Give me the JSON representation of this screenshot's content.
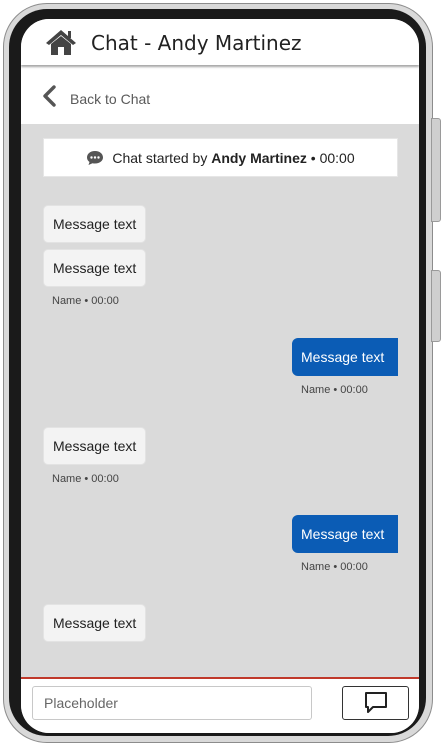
{
  "header": {
    "title": "Chat - Andy Martinez",
    "home_icon": "home-icon"
  },
  "nav": {
    "back_label": "Back to Chat",
    "back_icon": "chevron-left-icon"
  },
  "chat": {
    "started_prefix": "Chat started by",
    "started_name": "Andy Martinez",
    "started_suffix": "• 00:00",
    "messages": [
      {
        "direction": "incoming",
        "text": "Message text"
      },
      {
        "direction": "incoming",
        "text": "Message text",
        "meta": "Name • 00:00"
      },
      {
        "direction": "outgoing",
        "text": "Message text",
        "meta": "Name • 00:00"
      },
      {
        "direction": "incoming",
        "text": "Message text",
        "meta": "Name • 00:00"
      },
      {
        "direction": "outgoing",
        "text": "Message text",
        "meta": "Name • 00:00"
      },
      {
        "direction": "incoming",
        "text": "Message text"
      }
    ]
  },
  "composer": {
    "placeholder": "Placeholder",
    "send_icon": "chat-bubble-icon"
  },
  "colors": {
    "outgoing_bubble": "#0b5cb5",
    "chat_background": "#dadada",
    "divider": "#c0392b"
  }
}
